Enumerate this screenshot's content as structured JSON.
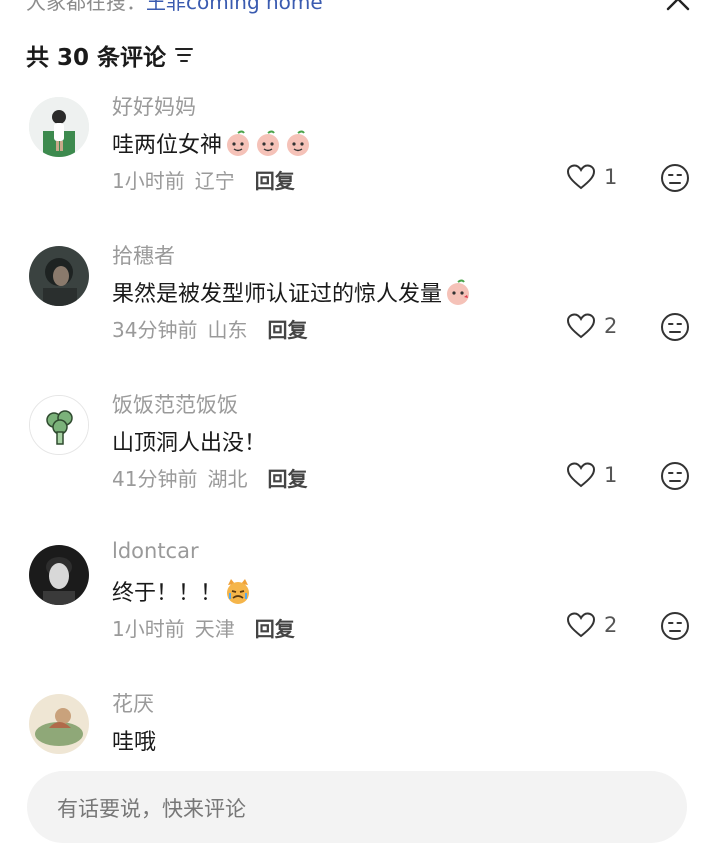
{
  "header": {
    "top_prefix": "大家都在搜：",
    "top_link": "王菲coming home",
    "comment_count": "共 30 条评论"
  },
  "comments": [
    {
      "user": "好好妈妈",
      "text": "哇两位女神",
      "emoji_count": 3,
      "time": "1小时前",
      "location": "辽宁",
      "reply": "回复",
      "likes": "1"
    },
    {
      "user": "拾穗者",
      "text": "果然是被发型师认证过的惊人发量",
      "emoji_count": 1,
      "time": "34分钟前",
      "location": "山东",
      "reply": "回复",
      "likes": "2"
    },
    {
      "user": "饭饭范范饭饭",
      "text": "山顶洞人出没！",
      "emoji_count": 0,
      "time": "41分钟前",
      "location": "湖北",
      "reply": "回复",
      "likes": "1"
    },
    {
      "user": "ldontcar",
      "text": "终于！！！",
      "emoji_count": 1,
      "time": "1小时前",
      "location": "天津",
      "reply": "回复",
      "likes": "2"
    },
    {
      "user": "花厌",
      "text": "哇哦"
    }
  ],
  "input": {
    "placeholder": "有话要说，快来评论"
  },
  "icons": {
    "close": "close-icon",
    "sort": "sort-icon",
    "like": "heart-icon",
    "dislike": "dislike-face-icon"
  }
}
